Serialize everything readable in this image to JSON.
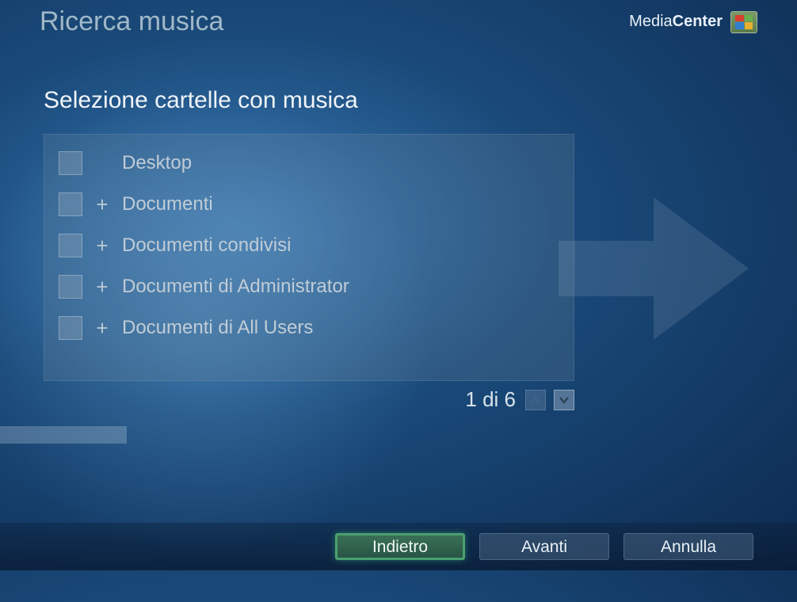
{
  "header": {
    "title": "Ricerca musica",
    "brand_thin": "Media",
    "brand_bold": "Center"
  },
  "subtitle": "Selezione cartelle con musica",
  "folders": [
    {
      "label": "Desktop",
      "expandable": false
    },
    {
      "label": "Documenti",
      "expandable": true
    },
    {
      "label": "Documenti condivisi",
      "expandable": true
    },
    {
      "label": "Documenti di Administrator",
      "expandable": true
    },
    {
      "label": "Documenti di All Users",
      "expandable": true
    }
  ],
  "expand_symbol": "+",
  "pager": {
    "text": "1 di 6"
  },
  "footer": {
    "back": "Indietro",
    "next": "Avanti",
    "cancel": "Annulla"
  }
}
